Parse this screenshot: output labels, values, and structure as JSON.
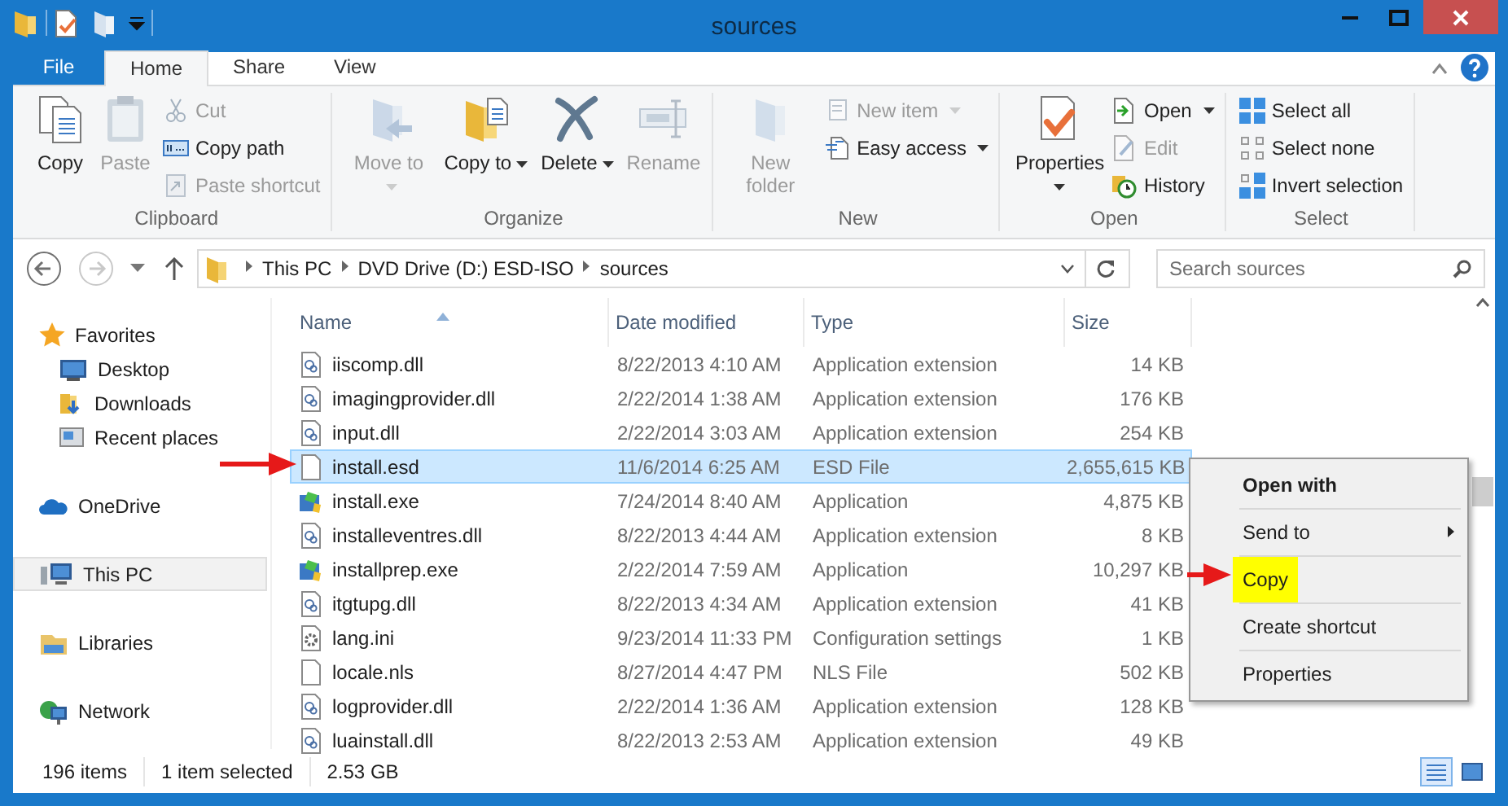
{
  "window": {
    "title": "sources"
  },
  "ribbon_tabs": [
    {
      "label": "File",
      "kind": "file",
      "selected": false
    },
    {
      "label": "Home",
      "kind": "tab",
      "selected": true
    },
    {
      "label": "Share",
      "kind": "tab",
      "selected": false
    },
    {
      "label": "View",
      "kind": "tab",
      "selected": false
    }
  ],
  "ribbon_groups": [
    {
      "label": "Clipboard",
      "commands": [
        {
          "label": "Copy",
          "kind": "large",
          "disabled": false,
          "dropdown": false
        },
        {
          "label": "Paste",
          "kind": "large",
          "disabled": true,
          "dropdown": false
        },
        {
          "label": "Cut",
          "kind": "small",
          "disabled": true,
          "dropdown": false
        },
        {
          "label": "Copy path",
          "kind": "small",
          "disabled": false,
          "dropdown": false
        },
        {
          "label": "Paste shortcut",
          "kind": "small",
          "disabled": true,
          "dropdown": false
        }
      ]
    },
    {
      "label": "Organize",
      "commands": [
        {
          "label": "Move to",
          "kind": "large",
          "disabled": true,
          "dropdown": true
        },
        {
          "label": "Copy to",
          "kind": "large",
          "disabled": false,
          "dropdown": true
        },
        {
          "label": "Delete",
          "kind": "large",
          "disabled": false,
          "dropdown": true
        },
        {
          "label": "Rename",
          "kind": "large",
          "disabled": true,
          "dropdown": false
        }
      ]
    },
    {
      "label": "New",
      "commands": [
        {
          "label": "New folder",
          "kind": "large",
          "disabled": true,
          "dropdown": false
        },
        {
          "label": "New item",
          "kind": "small",
          "disabled": true,
          "dropdown": true
        },
        {
          "label": "Easy access",
          "kind": "small",
          "disabled": false,
          "dropdown": true
        }
      ]
    },
    {
      "label": "Open",
      "commands": [
        {
          "label": "Properties",
          "kind": "large",
          "disabled": false,
          "dropdown": true
        },
        {
          "label": "Open",
          "kind": "small",
          "disabled": false,
          "dropdown": true
        },
        {
          "label": "Edit",
          "kind": "small",
          "disabled": true,
          "dropdown": false
        },
        {
          "label": "History",
          "kind": "small",
          "disabled": false,
          "dropdown": false
        }
      ]
    },
    {
      "label": "Select",
      "commands": [
        {
          "label": "Select all",
          "kind": "small",
          "disabled": false,
          "dropdown": false
        },
        {
          "label": "Select none",
          "kind": "small",
          "disabled": false,
          "dropdown": false
        },
        {
          "label": "Invert selection",
          "kind": "small",
          "disabled": false,
          "dropdown": false
        }
      ]
    }
  ],
  "nav_buttons": [
    {
      "kind": "back",
      "disabled": false
    },
    {
      "kind": "forward",
      "disabled": true
    }
  ],
  "address": {
    "crumbs": [
      "This PC",
      "DVD Drive (D:) ESD-ISO",
      "sources"
    ]
  },
  "search": {
    "placeholder": "Search sources"
  },
  "nav_pane": [
    {
      "label": "Favorites",
      "selected": false,
      "children": [
        {
          "label": "Desktop",
          "selected": false
        },
        {
          "label": "Downloads",
          "selected": false
        },
        {
          "label": "Recent places",
          "selected": false
        }
      ]
    },
    {
      "label": "OneDrive",
      "selected": false
    },
    {
      "label": "This PC",
      "selected": true
    },
    {
      "label": "Libraries",
      "selected": false
    },
    {
      "label": "Network",
      "selected": false
    }
  ],
  "file_list": {
    "columns": [
      {
        "label": "Name",
        "sorted": true
      },
      {
        "label": "Date modified",
        "sorted": false
      },
      {
        "label": "Type",
        "sorted": false
      },
      {
        "label": "Size",
        "sorted": false
      }
    ],
    "rows": [
      {
        "name": "iiscomp.dll",
        "date": "8/22/2013 4:10 AM",
        "type": "Application extension",
        "size": "14 KB",
        "kind": "dll",
        "selected": false
      },
      {
        "name": "imagingprovider.dll",
        "date": "2/22/2014 1:38 AM",
        "type": "Application extension",
        "size": "176 KB",
        "kind": "dll",
        "selected": false
      },
      {
        "name": "input.dll",
        "date": "2/22/2014 3:03 AM",
        "type": "Application extension",
        "size": "254 KB",
        "kind": "dll",
        "selected": false
      },
      {
        "name": "install.esd",
        "date": "11/6/2014 6:25 AM",
        "type": "ESD File",
        "size": "2,655,615 KB",
        "kind": "file",
        "selected": true
      },
      {
        "name": "install.exe",
        "date": "7/24/2014 8:40 AM",
        "type": "Application",
        "size": "4,875 KB",
        "kind": "exe",
        "selected": false
      },
      {
        "name": "installeventres.dll",
        "date": "8/22/2013 4:44 AM",
        "type": "Application extension",
        "size": "8 KB",
        "kind": "dll",
        "selected": false
      },
      {
        "name": "installprep.exe",
        "date": "2/22/2014 7:59 AM",
        "type": "Application",
        "size": "10,297 KB",
        "kind": "exe",
        "selected": false
      },
      {
        "name": "itgtupg.dll",
        "date": "8/22/2013 4:34 AM",
        "type": "Application extension",
        "size": "41 KB",
        "kind": "dll",
        "selected": false
      },
      {
        "name": "lang.ini",
        "date": "9/23/2014 11:33 PM",
        "type": "Configuration settings",
        "size": "1 KB",
        "kind": "settings",
        "selected": false
      },
      {
        "name": "locale.nls",
        "date": "8/27/2014 4:47 PM",
        "type": "NLS File",
        "size": "502 KB",
        "kind": "file",
        "selected": false
      },
      {
        "name": "logprovider.dll",
        "date": "2/22/2014 1:36 AM",
        "type": "Application extension",
        "size": "128 KB",
        "kind": "dll",
        "selected": false
      },
      {
        "name": "luainstall.dll",
        "date": "8/22/2013 2:53 AM",
        "type": "Application extension",
        "size": "49 KB",
        "kind": "dll",
        "selected": false
      }
    ]
  },
  "context_menu": {
    "items": [
      {
        "label": "Open with",
        "default": true,
        "submenu": false,
        "selected": false
      },
      {
        "label": "Send to",
        "default": false,
        "submenu": true,
        "selected": false
      },
      {
        "label": "Copy",
        "default": false,
        "submenu": false,
        "selected": true
      },
      {
        "label": "Create shortcut",
        "default": false,
        "submenu": false,
        "selected": false
      },
      {
        "label": "Properties",
        "default": false,
        "submenu": false,
        "selected": false
      }
    ]
  },
  "status_bar": {
    "items": "196 items",
    "selection": "1 item selected",
    "size": "2.53 GB",
    "views": [
      {
        "selected": true
      },
      {
        "selected": false
      }
    ]
  }
}
